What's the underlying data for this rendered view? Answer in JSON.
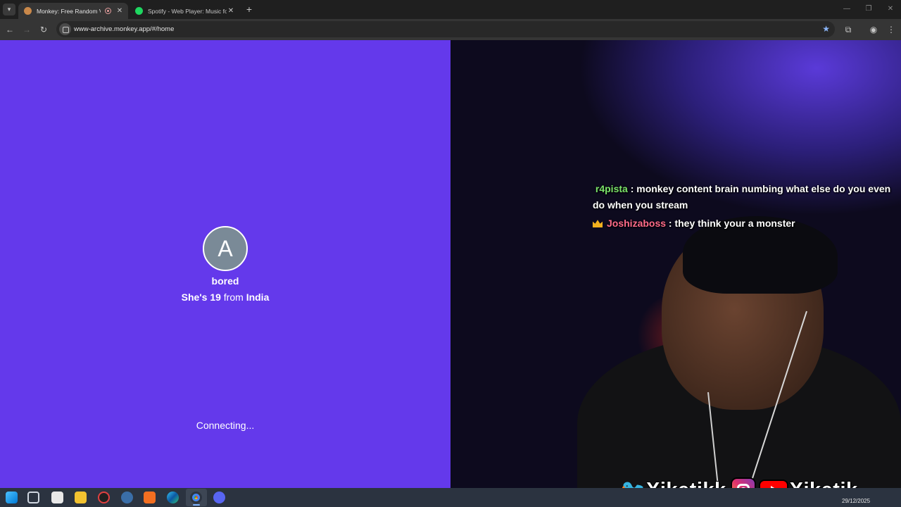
{
  "browser": {
    "tabs": [
      {
        "title": "Monkey: Free Random Video Chat",
        "active": true
      },
      {
        "title": "Spotify - Web Player: Music for everyone",
        "active": false
      }
    ],
    "url": "www-archive.monkey.app/#/home"
  },
  "profile": {
    "initial": "A",
    "username": "bored",
    "info_prefix": "She's",
    "age": "19",
    "info_mid": "from",
    "country": "India"
  },
  "status": "Connecting...",
  "stream_overlay": {
    "chat": [
      {
        "user": "r4pista",
        "message": " : monkey content brain numbing what else do you even do when you stream"
      },
      {
        "user": "Joshizaboss",
        "message": " : they think your a monster"
      }
    ],
    "social_handle_1": "Xiketikk",
    "social_handle_2": "Xiketik"
  },
  "taskbar": {
    "date": "29/12/2025"
  },
  "colors": {
    "page_bg": "#6439eb",
    "avatar_bg": "#7a8a97"
  }
}
